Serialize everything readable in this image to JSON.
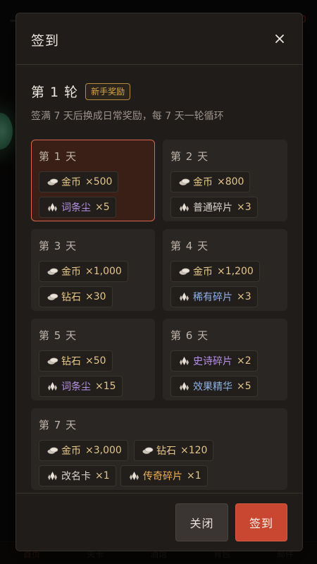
{
  "background": {
    "nav": [
      "首页",
      "关卡",
      "酒馆",
      "背包",
      "邮件"
    ]
  },
  "modal": {
    "title": "签到",
    "round_title": "第 1 轮",
    "badge": "新手奖励",
    "description": "签满 7 天后换成日常奖励，每 7 天一轮循环",
    "days": [
      {
        "label": "第 1 天",
        "rewards": [
          {
            "icon": "coin-icon",
            "name": "金币",
            "qty": "×500",
            "tone": "gold"
          },
          {
            "icon": "crystal-icon",
            "name": "词条尘",
            "qty": "×5",
            "tone": "purple"
          }
        ]
      },
      {
        "label": "第 2 天",
        "rewards": [
          {
            "icon": "coin-icon",
            "name": "金币",
            "qty": "×800",
            "tone": "gold"
          },
          {
            "icon": "crystal-icon",
            "name": "普通碎片",
            "qty": "×3",
            "tone": "white"
          }
        ]
      },
      {
        "label": "第 3 天",
        "rewards": [
          {
            "icon": "coin-icon",
            "name": "金币",
            "qty": "×1,000",
            "tone": "gold"
          },
          {
            "icon": "coin-icon",
            "name": "钻石",
            "qty": "×30",
            "tone": "gold"
          }
        ]
      },
      {
        "label": "第 4 天",
        "rewards": [
          {
            "icon": "coin-icon",
            "name": "金币",
            "qty": "×1,200",
            "tone": "gold"
          },
          {
            "icon": "crystal-icon",
            "name": "稀有碎片",
            "qty": "×3",
            "tone": "blue"
          }
        ]
      },
      {
        "label": "第 5 天",
        "rewards": [
          {
            "icon": "coin-icon",
            "name": "钻石",
            "qty": "×50",
            "tone": "gold"
          },
          {
            "icon": "crystal-icon",
            "name": "词条尘",
            "qty": "×15",
            "tone": "purple"
          }
        ]
      },
      {
        "label": "第 6 天",
        "rewards": [
          {
            "icon": "crystal-icon",
            "name": "史诗碎片",
            "qty": "×2",
            "tone": "purple"
          },
          {
            "icon": "crystal-icon",
            "name": "效果精华",
            "qty": "×5",
            "tone": "blue"
          }
        ]
      },
      {
        "label": "第 7 天",
        "rewards": [
          {
            "icon": "coin-icon",
            "name": "金币",
            "qty": "×3,000",
            "tone": "gold"
          },
          {
            "icon": "coin-icon",
            "name": "钻石",
            "qty": "×120",
            "tone": "gold"
          },
          {
            "icon": "crystal-icon",
            "name": "改名卡",
            "qty": "×1",
            "tone": "white"
          },
          {
            "icon": "crystal-icon",
            "name": "传奇碎片",
            "qty": "×1",
            "tone": "orange"
          }
        ]
      }
    ],
    "buttons": {
      "close": "关闭",
      "sign": "签到"
    }
  },
  "colors": {
    "accent": "#c94731",
    "current_border": "#d9674f",
    "badge": "#d8a84c"
  }
}
